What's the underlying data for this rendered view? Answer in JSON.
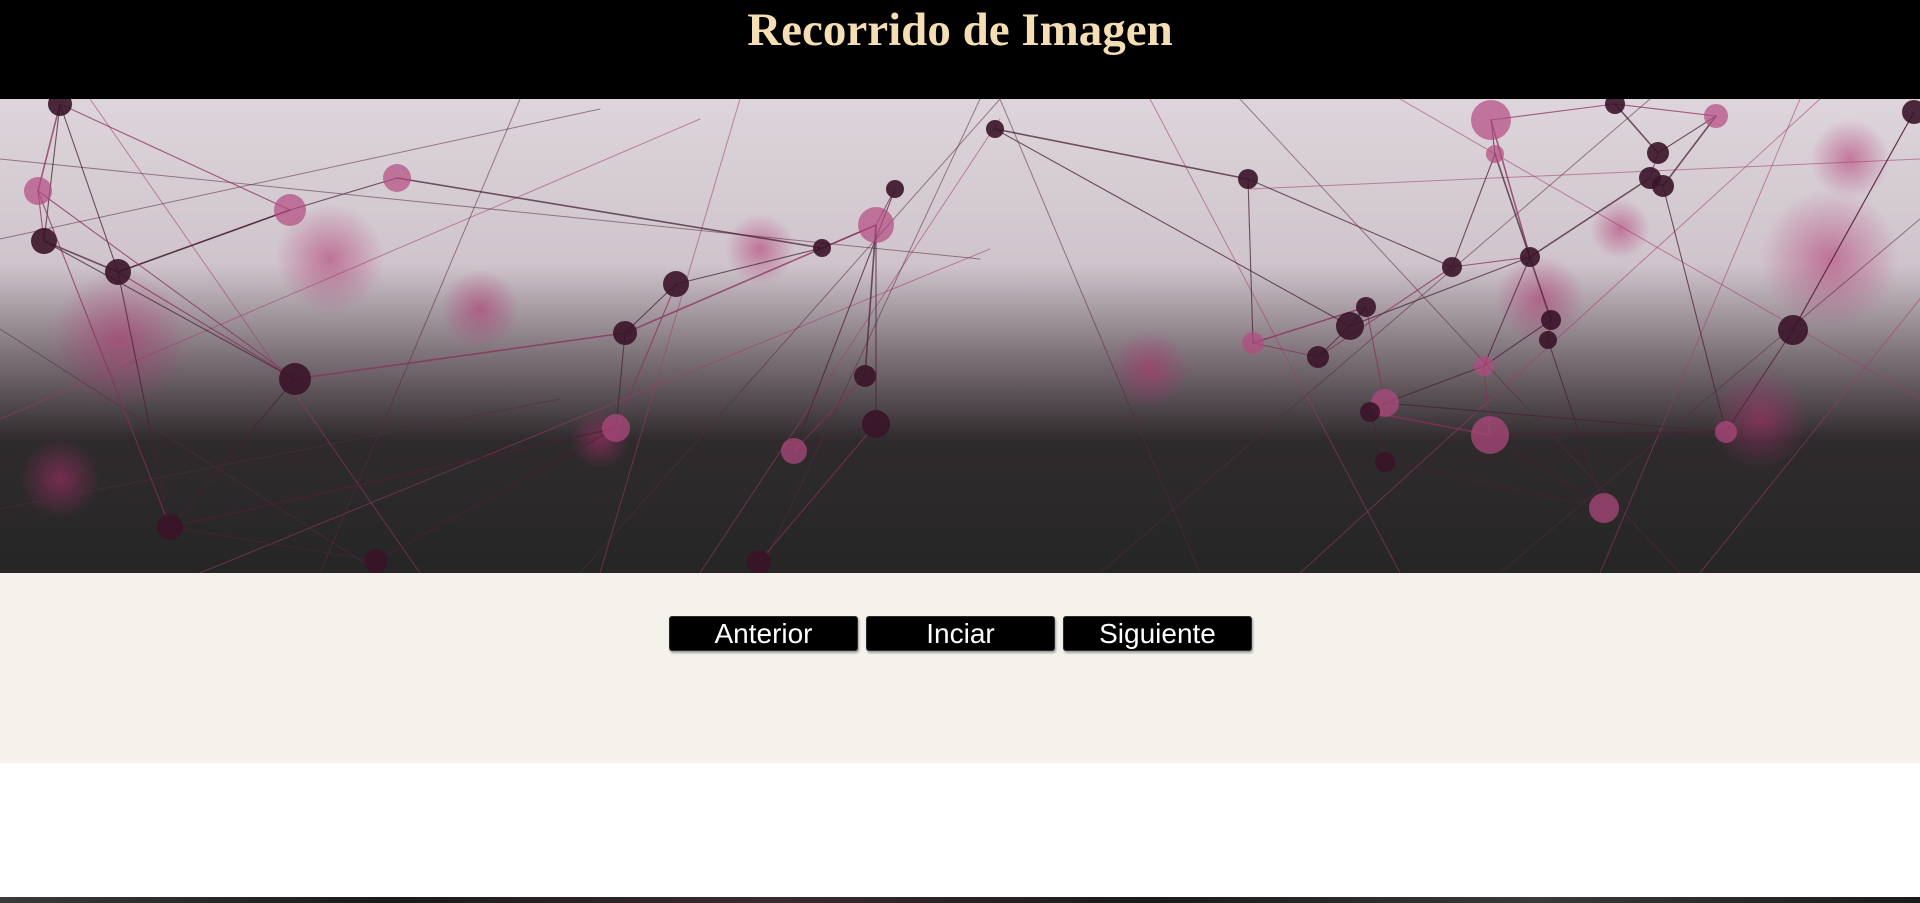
{
  "header": {
    "title": "Recorrido de Imagen",
    "title_color": "#f5deb3"
  },
  "banner": {
    "image": "network-nodes-image",
    "colors": {
      "top": "#ddd5db",
      "bottom": "#262626",
      "accent": "#a0306a",
      "node_dark": "#2a1020"
    }
  },
  "controls": {
    "buttons": [
      {
        "label": "Anterior",
        "name": "previous-button"
      },
      {
        "label": "Inciar",
        "name": "start-button"
      },
      {
        "label": "Siguiente",
        "name": "next-button"
      }
    ],
    "button_text_color": "#ffffff",
    "background": "#f5f2ec"
  }
}
